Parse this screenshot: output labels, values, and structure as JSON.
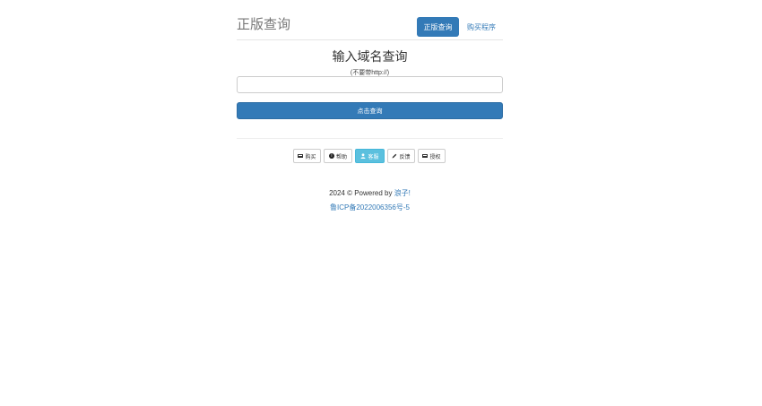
{
  "header": {
    "title": "正版查询",
    "nav": {
      "active_label": "正版查询",
      "buy_label": "购买程序"
    }
  },
  "query": {
    "title": "输入域名查询",
    "hint": "(不要带http://)",
    "input_value": "",
    "input_placeholder": "",
    "submit_label": "点击查询"
  },
  "buttons": [
    {
      "label": "购买",
      "icon": "flag-icon",
      "style": "default"
    },
    {
      "label": "帮助",
      "icon": "info-icon",
      "style": "default"
    },
    {
      "label": "客服",
      "icon": "user-icon",
      "style": "info"
    },
    {
      "label": "反馈",
      "icon": "pencil-icon",
      "style": "default"
    },
    {
      "label": "授权",
      "icon": "flag-icon",
      "style": "default"
    }
  ],
  "footer": {
    "copyright_prefix": "2024 © Powered by",
    "author_link": "浪子!",
    "icp": "鲁ICP备2022006356号-5"
  },
  "colors": {
    "primary": "#337ab7",
    "info": "#5bc0de"
  }
}
